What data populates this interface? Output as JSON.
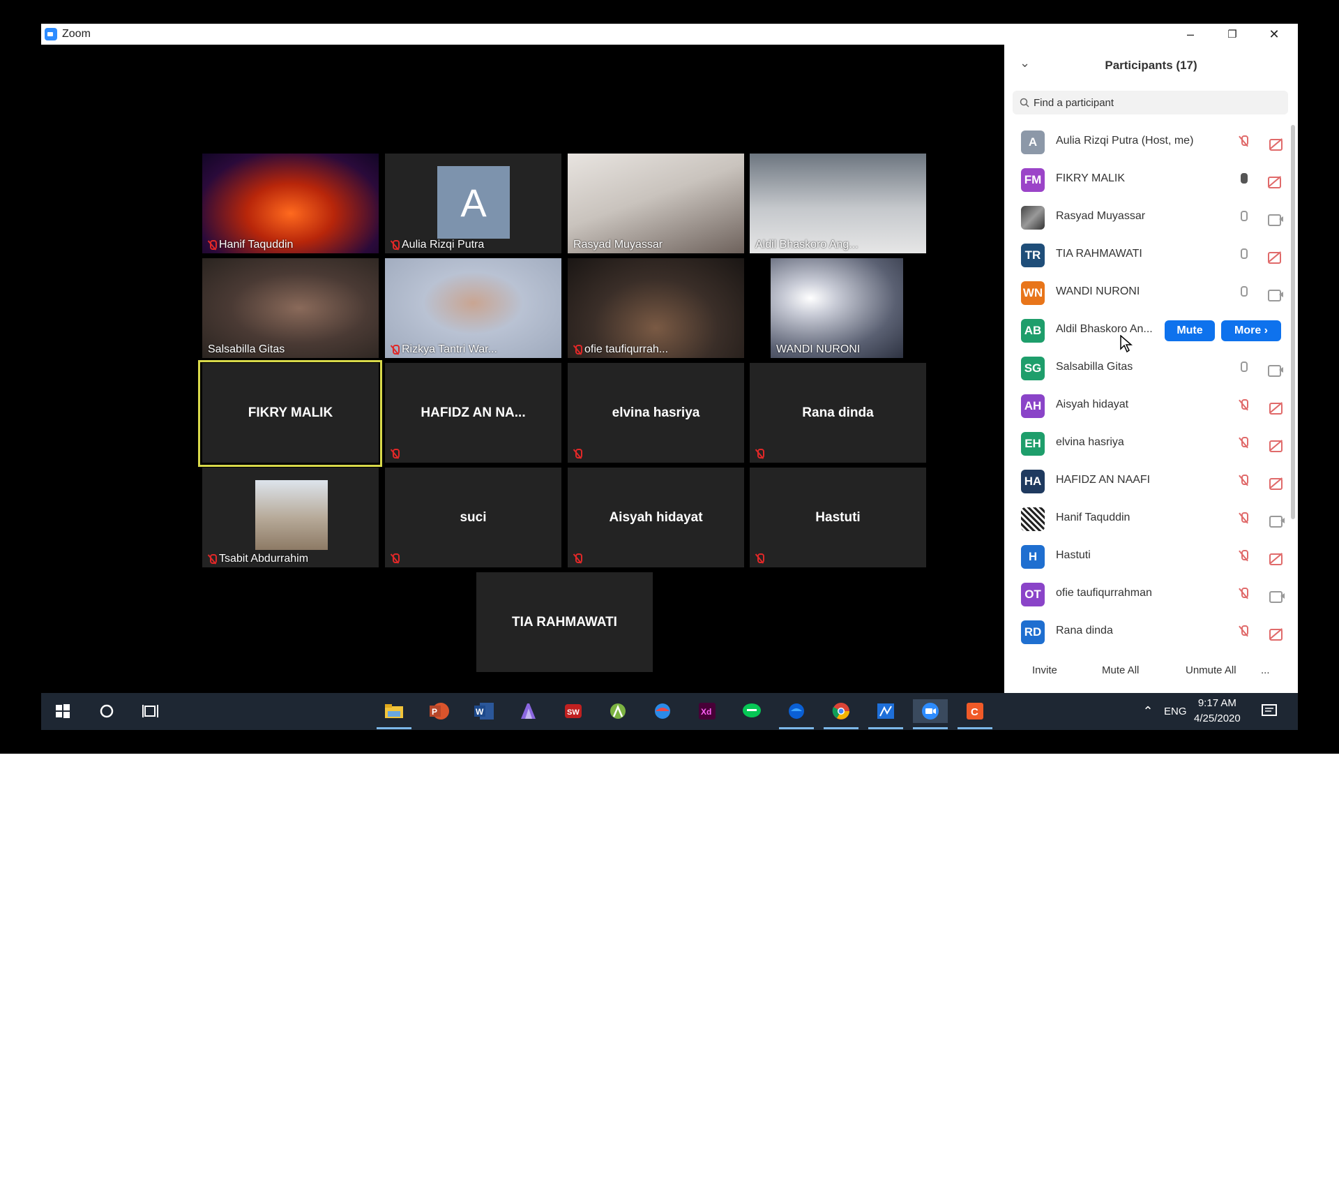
{
  "window": {
    "title": "Zoom",
    "minimize": "–",
    "restore": "❐",
    "close": "✕"
  },
  "tiles": [
    {
      "name": "Hanif Taquddin",
      "muted": true,
      "type": "video",
      "bg": "concert"
    },
    {
      "name": "Aulia Rizqi Putra",
      "muted": true,
      "type": "avatar",
      "letter": "A"
    },
    {
      "name": "Rasyad Muyassar",
      "muted": false,
      "type": "video",
      "bg": "room"
    },
    {
      "name": "Aldil Bhaskoro Ang...",
      "muted": false,
      "type": "video",
      "bg": "person"
    },
    {
      "name": "Salsabilla Gitas",
      "muted": false,
      "type": "video",
      "bg": "dark"
    },
    {
      "name": "Rizkya Tantri War...",
      "muted": true,
      "type": "video",
      "bg": "hijab"
    },
    {
      "name": "ofie taufiqurrah...",
      "muted": true,
      "type": "video",
      "bg": "dim"
    },
    {
      "name": "WANDI NURONI",
      "muted": false,
      "type": "video",
      "bg": "blur"
    },
    {
      "name": "FIKRY MALIK",
      "muted": false,
      "type": "name"
    },
    {
      "name": "HAFIDZ AN NA...",
      "muted": true,
      "type": "name"
    },
    {
      "name": "elvina hasriya",
      "muted": true,
      "type": "name"
    },
    {
      "name": "Rana dinda",
      "muted": true,
      "type": "name"
    },
    {
      "name": "Tsabit Abdurrahim",
      "muted": true,
      "type": "photo"
    },
    {
      "name": "suci",
      "muted": true,
      "type": "name"
    },
    {
      "name": "Aisyah hidayat",
      "muted": true,
      "type": "name"
    },
    {
      "name": "Hastuti",
      "muted": true,
      "type": "name"
    },
    {
      "name": "TIA RAHMAWATI",
      "muted": false,
      "type": "name"
    }
  ],
  "panel": {
    "title": "Participants (17)",
    "search_placeholder": "Find a participant",
    "participants": [
      {
        "initials": "A",
        "name": "Aulia Rizqi Putra (Host, me)",
        "color": "#8c98a8",
        "mic": "off",
        "cam": "off"
      },
      {
        "initials": "FM",
        "name": "FIKRY MALIK",
        "color": "#9b44c8",
        "mic": "talking",
        "cam": "off"
      },
      {
        "initials": "",
        "name": "Rasyad Muyassar",
        "color": "#555555",
        "mic": "on",
        "cam": "on"
      },
      {
        "initials": "TR",
        "name": "TIA RAHMAWATI",
        "color": "#1f4e79",
        "mic": "on",
        "cam": "off"
      },
      {
        "initials": "WN",
        "name": "WANDI NURONI",
        "color": "#e8751a",
        "mic": "on",
        "cam": "on"
      },
      {
        "initials": "AB",
        "name": "Aldil Bhaskoro An...",
        "color": "#1e9e6b",
        "mic": "buttons",
        "cam": "buttons"
      },
      {
        "initials": "SG",
        "name": "Salsabilla Gitas",
        "color": "#1e9e6b",
        "mic": "on",
        "cam": "on"
      },
      {
        "initials": "AH",
        "name": "Aisyah hidayat",
        "color": "#8a44c8",
        "mic": "off",
        "cam": "off"
      },
      {
        "initials": "EH",
        "name": "elvina hasriya",
        "color": "#1e9e6b",
        "mic": "off",
        "cam": "off"
      },
      {
        "initials": "HA",
        "name": "HAFIDZ AN NAAFI",
        "color": "#1f3a5f",
        "mic": "off",
        "cam": "off"
      },
      {
        "initials": "",
        "name": "Hanif Taquddin",
        "color": "#ffffff",
        "mic": "off",
        "cam": "on"
      },
      {
        "initials": "H",
        "name": "Hastuti",
        "color": "#1f6fd0",
        "mic": "off",
        "cam": "off"
      },
      {
        "initials": "OT",
        "name": "ofie taufiqurrahman",
        "color": "#8a44c8",
        "mic": "off",
        "cam": "on"
      },
      {
        "initials": "RD",
        "name": "Rana dinda",
        "color": "#1f6fd0",
        "mic": "off",
        "cam": "off"
      }
    ],
    "mute_label": "Mute",
    "more_label": "More ›",
    "footer": {
      "invite": "Invite",
      "mute_all": "Mute All",
      "unmute_all": "Unmute All",
      "more": "..."
    }
  },
  "taskbar": {
    "lang": "ENG",
    "time": "9:17 AM",
    "date": "4/25/2020"
  }
}
